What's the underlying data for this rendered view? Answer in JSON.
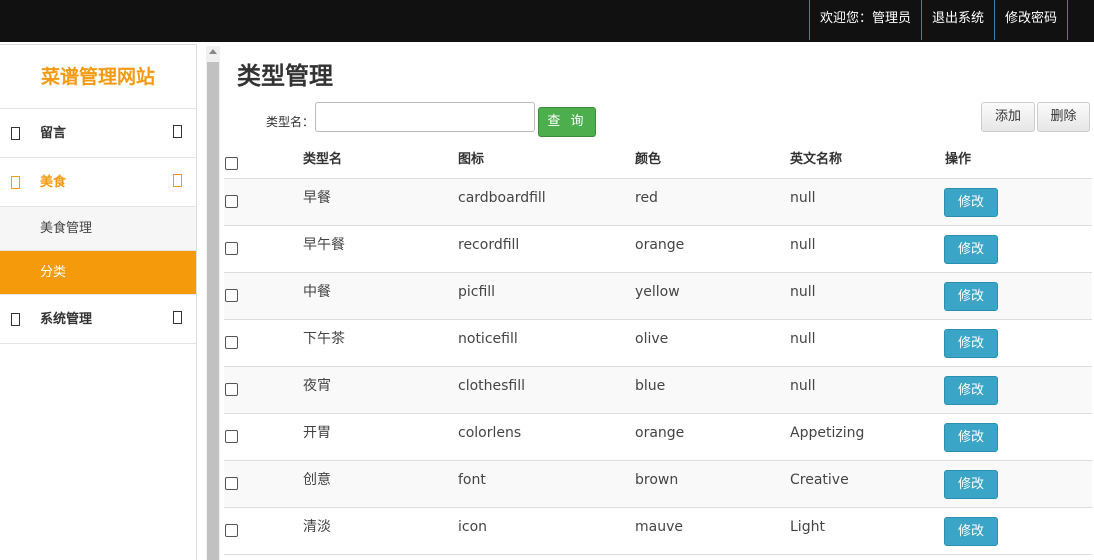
{
  "topnav": {
    "welcome": "欢迎您：管理员",
    "logout": "退出系统",
    "change_password": "修改密码"
  },
  "sidebar": {
    "brand": "菜谱管理网站",
    "items": [
      {
        "label": "留言"
      },
      {
        "label": "美食",
        "active": true,
        "children": [
          {
            "label": "美食管理"
          },
          {
            "label": "分类",
            "selected": true
          }
        ]
      },
      {
        "label": "系统管理"
      }
    ]
  },
  "main": {
    "title": "类型管理",
    "search": {
      "label": "类型名：",
      "value": "",
      "placeholder": "",
      "query_button": "查 询"
    },
    "add_button": "添加",
    "delete_button": "删除",
    "table": {
      "headers": [
        "类型名",
        "图标",
        "颜色",
        "英文名称",
        "操作"
      ],
      "edit_label": "修改",
      "rows": [
        {
          "name": "早餐",
          "icon": "cardboardfill",
          "color": "red",
          "en": "null"
        },
        {
          "name": "早午餐",
          "icon": "recordfill",
          "color": "orange",
          "en": "null"
        },
        {
          "name": "中餐",
          "icon": "picfill",
          "color": "yellow",
          "en": "null"
        },
        {
          "name": "下午茶",
          "icon": "noticefill",
          "color": "olive",
          "en": "null"
        },
        {
          "name": "夜宵",
          "icon": "clothesfill",
          "color": "blue",
          "en": "null"
        },
        {
          "name": "开胃",
          "icon": "colorlens",
          "color": "orange",
          "en": "Appetizing"
        },
        {
          "name": "创意",
          "icon": "font",
          "color": "brown",
          "en": "Creative"
        },
        {
          "name": "清淡",
          "icon": "icon",
          "color": "mauve",
          "en": "Light"
        }
      ]
    }
  }
}
